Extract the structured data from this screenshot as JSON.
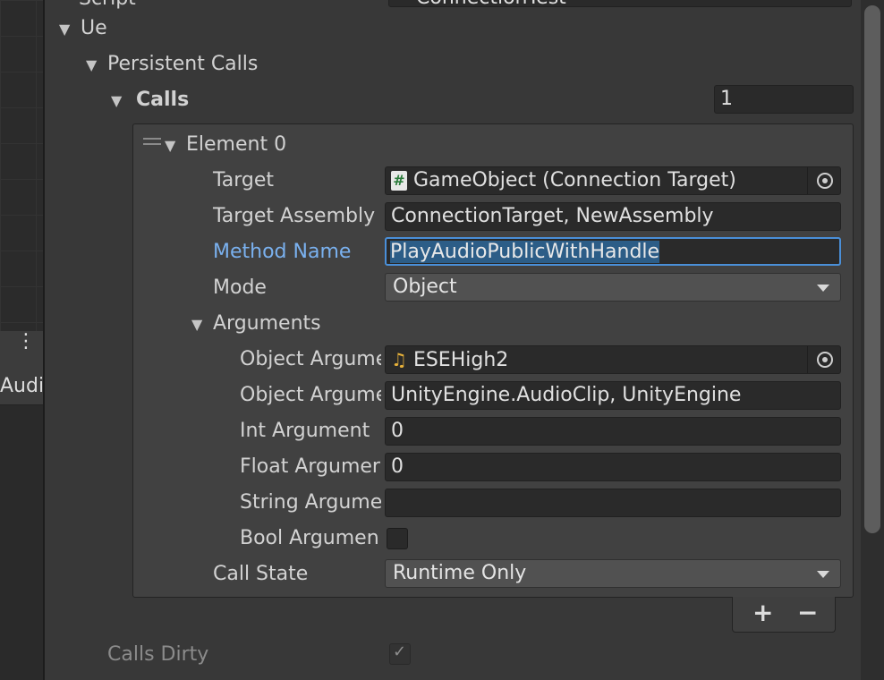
{
  "top_cut": {
    "label": "Script",
    "value": "ConnectionTest"
  },
  "left_tab": {
    "label": "Audio"
  },
  "tree": {
    "ue": "Ue",
    "persistent_calls": "Persistent Calls",
    "calls": {
      "label": "Calls",
      "count": "1"
    }
  },
  "element": {
    "title": "Element 0",
    "target": {
      "label": "Target",
      "value": "GameObject (Connection Target)",
      "icon": "#"
    },
    "target_assembly": {
      "label": "Target Assembly",
      "value": "ConnectionTarget, NewAssembly"
    },
    "method_name": {
      "label": "Method Name",
      "value": "PlayAudioPublicWithHandle"
    },
    "mode": {
      "label": "Mode",
      "value": "Object"
    },
    "arguments": {
      "label": "Arguments",
      "object_argument": {
        "label": "Object Argume",
        "value": "ESEHigh2",
        "icon": "♫"
      },
      "object_argument_type": {
        "label": "Object Argume",
        "value": "UnityEngine.AudioClip, UnityEngine"
      },
      "int_argument": {
        "label": "Int Argument",
        "value": "0"
      },
      "float_argument": {
        "label": "Float Argumer",
        "value": "0"
      },
      "string_argument": {
        "label": "String Argume",
        "value": ""
      },
      "bool_argument": {
        "label": "Bool Argumen",
        "checked": false
      }
    },
    "call_state": {
      "label": "Call State",
      "value": "Runtime Only"
    }
  },
  "list_controls": {
    "add": "+",
    "remove": "−"
  },
  "calls_dirty": {
    "label": "Calls Dirty",
    "checked": true
  },
  "colors": {
    "background": "#383838",
    "field": "#2a2a2a",
    "selection": "#2c5d87",
    "focus_label": "#7ab1ef"
  }
}
